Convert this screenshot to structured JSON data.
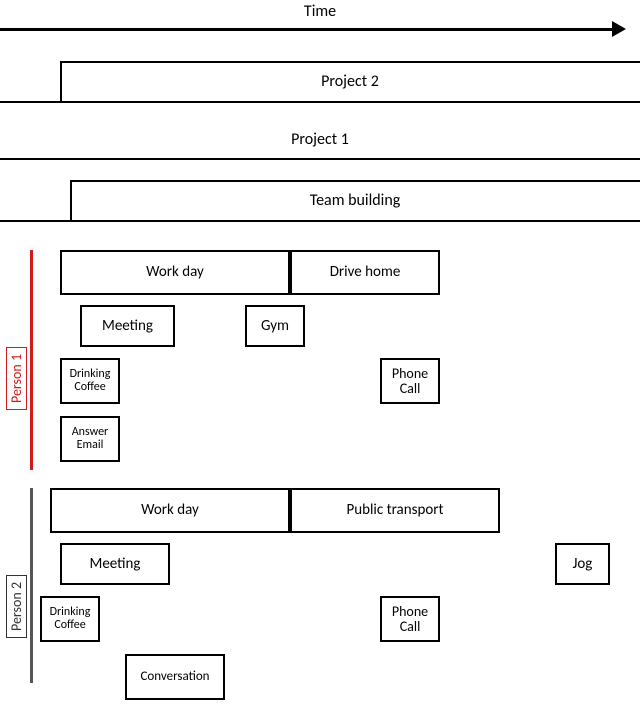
{
  "time_label": "Time",
  "people": {
    "p1": "Person 1",
    "p2": "Person 2"
  },
  "shared": {
    "project2": "Project 2",
    "project1": "Project 1",
    "team_building": "Team building"
  },
  "p1": {
    "work_day": "Work day",
    "drive_home": "Drive home",
    "meeting": "Meeting",
    "gym": "Gym",
    "drinking_coffee": "Drinking Coffee",
    "phone_call": "Phone Call",
    "answer_email": "Answer Email"
  },
  "p2": {
    "work_day": "Work day",
    "public_transport": "Public transport",
    "meeting": "Meeting",
    "jog": "Jog",
    "drinking_coffee": "Drinking Coffee",
    "phone_call": "Phone Call",
    "conversation": "Conversation"
  },
  "chart_data": {
    "type": "table",
    "title": "Nested timeline of activities for two people across a single time axis",
    "axis": "Time (left → right)",
    "rows": [
      {
        "lane": "shared",
        "level": 0,
        "label": "Project 2",
        "start": 0.07,
        "end": 1.0
      },
      {
        "lane": "shared",
        "level": 1,
        "label": "Project 1",
        "start": 0.0,
        "end": 1.0
      },
      {
        "lane": "shared",
        "level": 2,
        "label": "Team building",
        "start": 0.08,
        "end": 1.0
      },
      {
        "lane": "Person 1",
        "level": 0,
        "label": "Work day",
        "start": 0.05,
        "end": 0.45
      },
      {
        "lane": "Person 1",
        "level": 0,
        "label": "Drive home",
        "start": 0.45,
        "end": 0.7
      },
      {
        "lane": "Person 1",
        "level": 1,
        "label": "Meeting",
        "start": 0.08,
        "end": 0.23
      },
      {
        "lane": "Person 1",
        "level": 1,
        "label": "Gym",
        "start": 0.35,
        "end": 0.46
      },
      {
        "lane": "Person 1",
        "level": 2,
        "label": "Drinking Coffee",
        "start": 0.05,
        "end": 0.15
      },
      {
        "lane": "Person 1",
        "level": 2,
        "label": "Phone Call",
        "start": 0.58,
        "end": 0.7
      },
      {
        "lane": "Person 1",
        "level": 3,
        "label": "Answer Email",
        "start": 0.05,
        "end": 0.15
      },
      {
        "lane": "Person 2",
        "level": 0,
        "label": "Work day",
        "start": 0.05,
        "end": 0.45
      },
      {
        "lane": "Person 2",
        "level": 0,
        "label": "Public transport",
        "start": 0.45,
        "end": 0.8
      },
      {
        "lane": "Person 2",
        "level": 1,
        "label": "Meeting",
        "start": 0.05,
        "end": 0.23
      },
      {
        "lane": "Person 2",
        "level": 1,
        "label": "Jog",
        "start": 0.85,
        "end": 0.95
      },
      {
        "lane": "Person 2",
        "level": 2,
        "label": "Drinking Coffee",
        "start": 0.02,
        "end": 0.12
      },
      {
        "lane": "Person 2",
        "level": 2,
        "label": "Phone Call",
        "start": 0.58,
        "end": 0.7
      },
      {
        "lane": "Person 2",
        "level": 3,
        "label": "Conversation",
        "start": 0.15,
        "end": 0.32
      }
    ]
  }
}
